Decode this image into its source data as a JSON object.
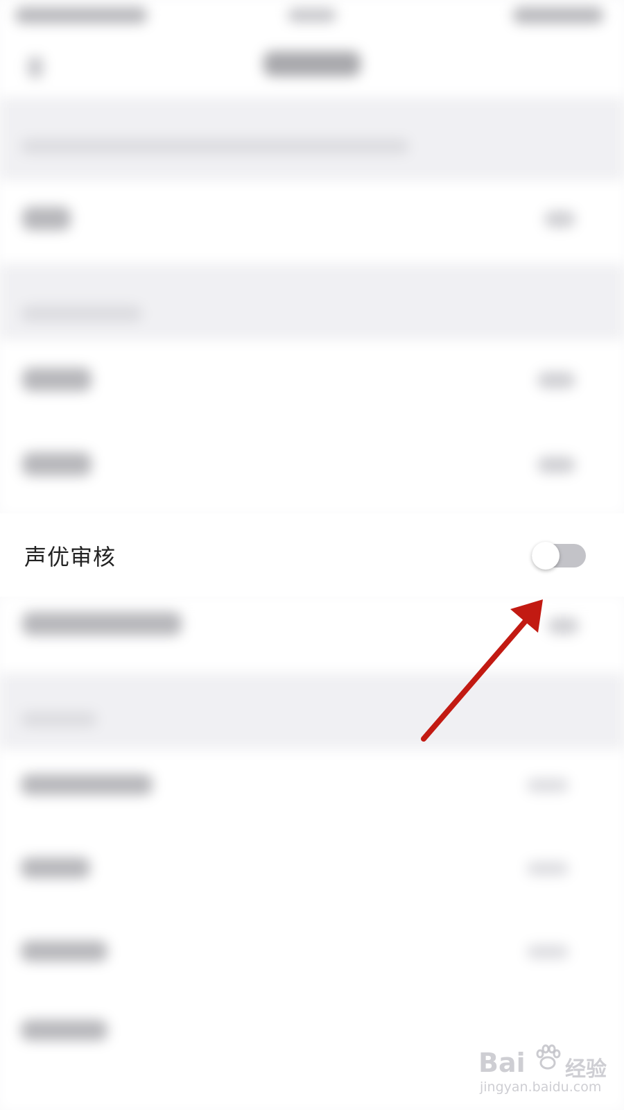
{
  "settings": {
    "review_item": {
      "label": "声优审核",
      "toggle_on": false
    }
  },
  "watermark": {
    "brand": "Bai",
    "brand_tail": "经验",
    "url": "jingyan.baidu.com"
  },
  "colors": {
    "annotation_arrow": "#c21a12",
    "toggle_track_off": "#c3c3c8",
    "toggle_knob": "#ffffff",
    "label_text": "#222222"
  }
}
